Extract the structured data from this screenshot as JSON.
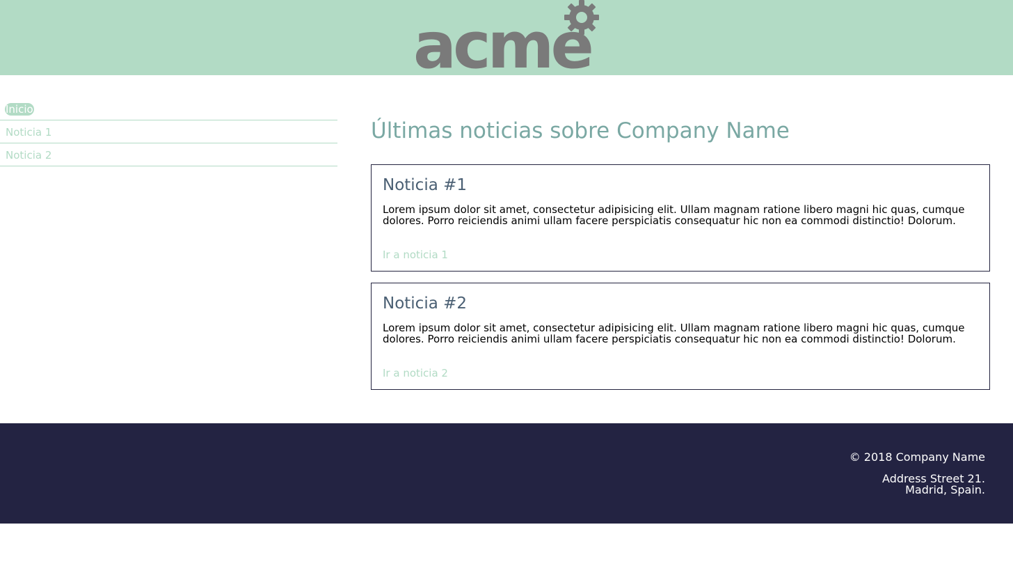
{
  "header": {
    "logo_text": "acme",
    "background_color": "#b2dbc5",
    "logo_color": "#7a7a7a",
    "logo_icon": "gear-icon"
  },
  "sidebar": {
    "items": [
      {
        "label": "Inicio",
        "active": true
      },
      {
        "label": "Noticia 1",
        "active": false
      },
      {
        "label": "Noticia 2",
        "active": false
      }
    ]
  },
  "main": {
    "title": "Últimas noticias sobre Company Name",
    "news": [
      {
        "title": "Noticia #1",
        "body": "Lorem ipsum dolor sit amet, consectetur adipisicing elit. Ullam magnam ratione libero magni hic quas, cumque dolores. Porro reiciendis animi ullam facere perspiciatis consequatur hic non ea commodi distinctio! Dolorum.",
        "link": "Ir a noticia 1"
      },
      {
        "title": "Noticia #2",
        "body": "Lorem ipsum dolor sit amet, consectetur adipisicing elit. Ullam magnam ratione libero magni hic quas, cumque dolores. Porro reiciendis animi ullam facere perspiciatis consequatur hic non ea commodi distinctio! Dolorum.",
        "link": "Ir a noticia 2"
      }
    ]
  },
  "footer": {
    "copyright": "© 2018 Company Name",
    "address_line1": "Address Street 21.",
    "address_line2": "Madrid, Spain.",
    "background_color": "#232342"
  }
}
